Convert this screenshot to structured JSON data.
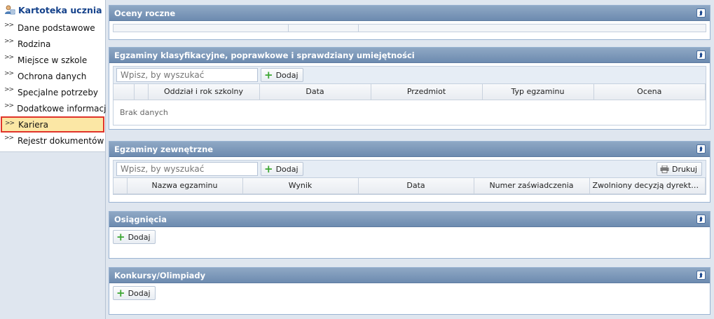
{
  "sidebar": {
    "title": "Kartoteka ucznia",
    "items": [
      {
        "label": "Dane podstawowe"
      },
      {
        "label": "Rodzina"
      },
      {
        "label": "Miejsce w szkole"
      },
      {
        "label": "Ochrona danych"
      },
      {
        "label": "Specjalne potrzeby"
      },
      {
        "label": "Dodatkowe informacje"
      },
      {
        "label": "Kariera"
      },
      {
        "label": "Rejestr dokumentów"
      }
    ],
    "active_index": 6
  },
  "panels": {
    "oceny": {
      "title": "Oceny roczne"
    },
    "egzaminy_klas": {
      "title": "Egzaminy klasyfikacyjne, poprawkowe i sprawdziany umiejętności",
      "search_placeholder": "Wpisz, by wyszukać",
      "add_label": "Dodaj",
      "columns": [
        "Oddział i rok szkolny",
        "Data",
        "Przedmiot",
        "Typ egzaminu",
        "Ocena"
      ],
      "empty_text": "Brak danych"
    },
    "egzaminy_zewn": {
      "title": "Egzaminy zewnętrzne",
      "search_placeholder": "Wpisz, by wyszukać",
      "add_label": "Dodaj",
      "print_label": "Drukuj",
      "columns": [
        "Nazwa egzaminu",
        "Wynik",
        "Data",
        "Numer zaświadczenia",
        "Zwolniony decyzją dyrektora ..."
      ]
    },
    "osiagniecia": {
      "title": "Osiągnięcia",
      "add_label": "Dodaj"
    },
    "konkursy": {
      "title": "Konkursy/Olimpiady",
      "add_label": "Dodaj"
    }
  },
  "icons": {
    "collapse": "double-chevron-up-icon",
    "nav": "double-chevron-right-icon",
    "user": "user-card-icon",
    "add": "plus-icon",
    "print": "printer-icon"
  },
  "colors": {
    "header": "#6d8bb0",
    "active_bg": "#fbe7a5",
    "active_border": "#e0342a",
    "title": "#15428b"
  }
}
